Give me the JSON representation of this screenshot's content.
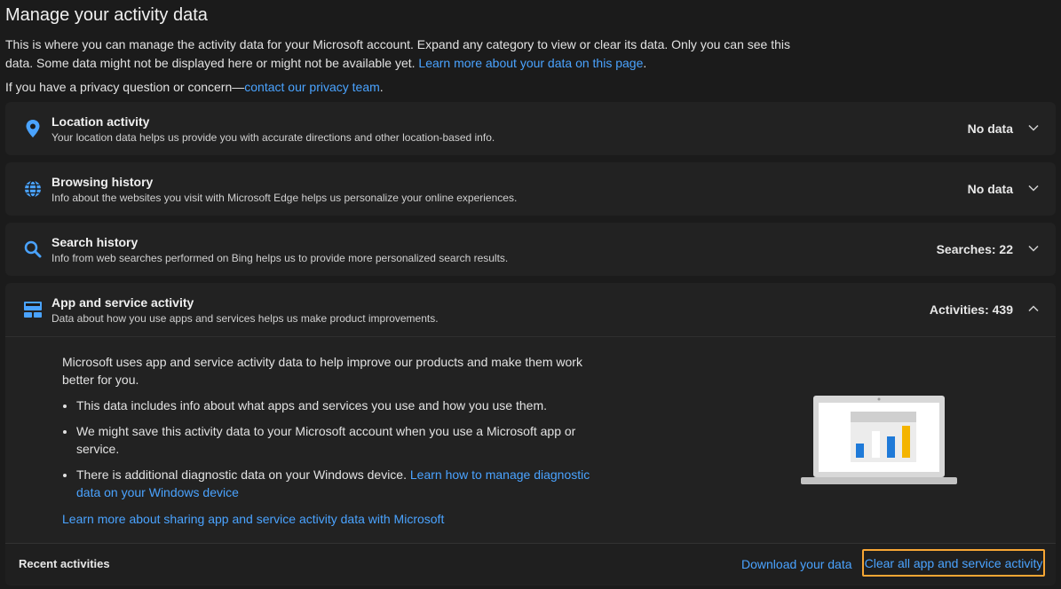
{
  "page": {
    "title": "Manage your activity data",
    "intro_text": "This is where you can manage the activity data for your Microsoft account. Expand any category to view or clear its data. Only you can see this data. Some data might not be displayed here or might not be available yet. ",
    "intro_link": "Learn more about your data on this page",
    "intro_end": ".",
    "privacy_text": "If you have a privacy question or concern—",
    "privacy_link": "contact our privacy team",
    "privacy_end": "."
  },
  "categories": [
    {
      "title": "Location activity",
      "subtitle": "Your location data helps us provide you with accurate directions and other location-based info.",
      "status": "No data",
      "icon": "location-pin-icon"
    },
    {
      "title": "Browsing history",
      "subtitle": "Info about the websites you visit with Microsoft Edge helps us personalize your online experiences.",
      "status": "No data",
      "icon": "globe-icon"
    },
    {
      "title": "Search history",
      "subtitle": "Info from web searches performed on Bing helps us to provide more personalized search results.",
      "status": "Searches: 22",
      "icon": "search-icon"
    },
    {
      "title": "App and service activity",
      "subtitle": "Data about how you use apps and services helps us make product improvements.",
      "status": "Activities: 439",
      "icon": "app-window-icon"
    }
  ],
  "expanded": {
    "intro": "Microsoft uses app and service activity data to help improve our products and make them work better for you.",
    "bullets": [
      "This data includes info about what apps and services you use and how you use them.",
      "We might save this activity data to your Microsoft account when you use a Microsoft app or service.",
      "There is additional diagnostic data on your Windows device. "
    ],
    "bullet3_link": "Learn how to manage diagnostic data on your Windows device",
    "learn_more": "Learn more about sharing app and service activity data with Microsoft"
  },
  "recent": {
    "label": "Recent activities",
    "download": "Download your data",
    "clear_all": "Clear all app and service activity"
  },
  "colors": {
    "accent_link": "#4aa3ff",
    "highlight": "#f7a634",
    "chart_blue": "#1f7ad8",
    "chart_yellow": "#f4b400"
  }
}
